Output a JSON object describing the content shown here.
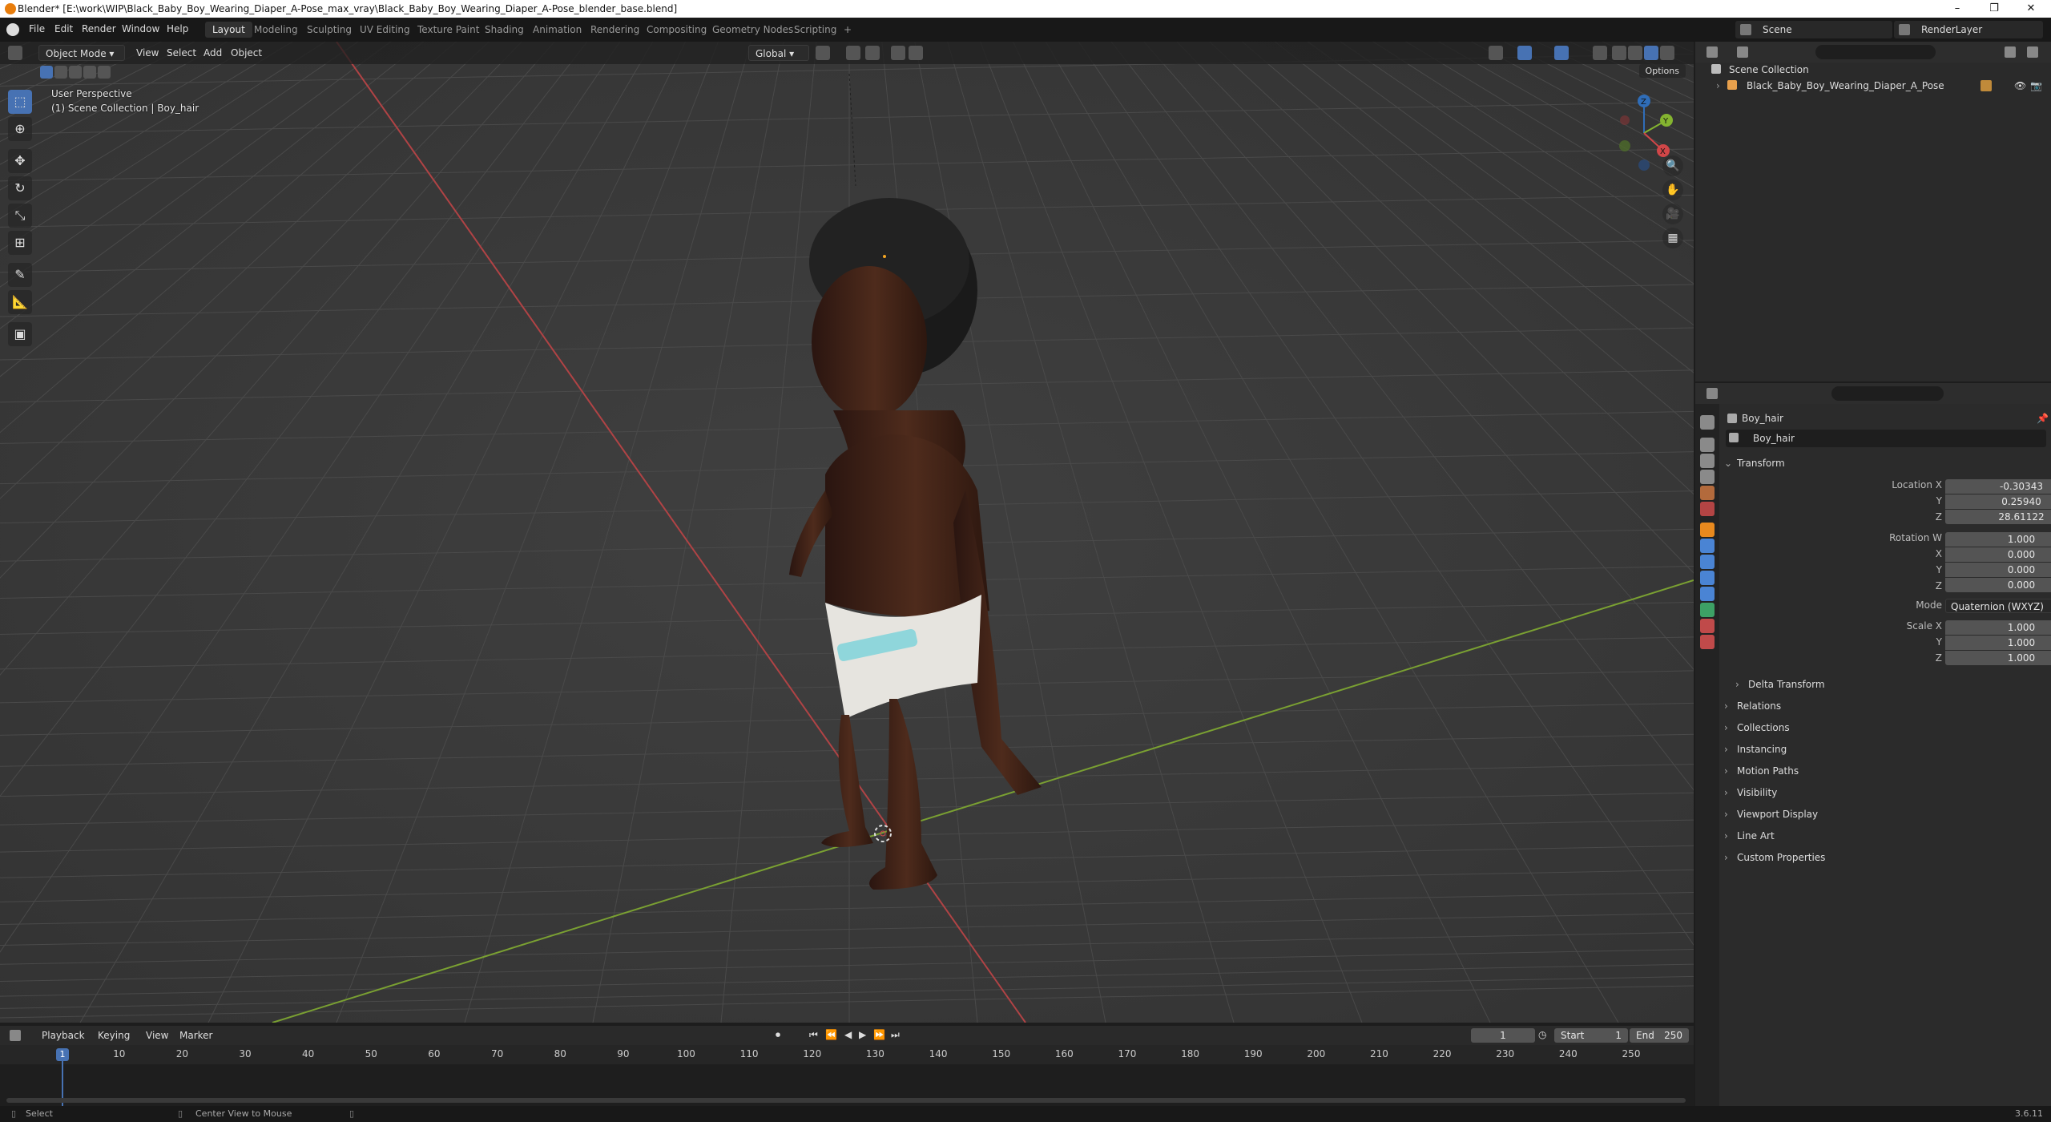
{
  "window": {
    "title": "Blender* [E:\\work\\WIP\\Black_Baby_Boy_Wearing_Diaper_A-Pose_max_vray\\Black_Baby_Boy_Wearing_Diaper_A-Pose_blender_base.blend]",
    "controls": [
      "–",
      "❐",
      "✕"
    ]
  },
  "menu": {
    "items": [
      "File",
      "Edit",
      "Render",
      "Window",
      "Help"
    ]
  },
  "workspaces": {
    "tabs": [
      "Layout",
      "Modeling",
      "Sculpting",
      "UV Editing",
      "Texture Paint",
      "Shading",
      "Animation",
      "Rendering",
      "Compositing",
      "Geometry Nodes",
      "Scripting"
    ],
    "add": "+",
    "active": "Layout"
  },
  "scene": {
    "name": "Scene",
    "view_layer": "RenderLayer"
  },
  "viewport": {
    "mode": "Object Mode",
    "menus": [
      "View",
      "Select",
      "Add",
      "Object"
    ],
    "orientation": "Global",
    "options_label": "Options",
    "overlay_line1": "User Perspective",
    "overlay_line2": "(1) Scene Collection | Boy_hair",
    "gizmo_axes": [
      "Z",
      "Y",
      "X"
    ],
    "bg_color": "#3a3a3a",
    "x_axis_color": "#d04648",
    "y_axis_color": "#84b430"
  },
  "toolbar": {
    "tools": [
      "select-box",
      "cursor",
      "move",
      "rotate",
      "scale",
      "transform",
      "annotate",
      "measure",
      "add-cube"
    ]
  },
  "outliner": {
    "root": "Scene Collection",
    "items": [
      {
        "label": "Black_Baby_Boy_Wearing_Diaper_A_Pose"
      }
    ]
  },
  "properties": {
    "object_name": "Boy_hair",
    "data_name": "Boy_hair",
    "transform_title": "Transform",
    "location_label": "Location X",
    "location": {
      "x": "-0.30343",
      "y": "0.25940",
      "z": "28.61122"
    },
    "rotation_label": "Rotation W",
    "rotation": {
      "w": "1.000",
      "x": "0.000",
      "y": "0.000",
      "z": "0.000"
    },
    "mode_label": "Mode",
    "mode_value": "Quaternion (WXYZ)",
    "scale_label": "Scale X",
    "scale": {
      "x": "1.000",
      "y": "1.000",
      "z": "1.000"
    },
    "axis_y": "Y",
    "axis_z": "Z",
    "axis_x": "X",
    "subpanels": [
      "Delta Transform",
      "Relations",
      "Collections",
      "Instancing",
      "Motion Paths",
      "Visibility",
      "Viewport Display",
      "Line Art",
      "Custom Properties"
    ]
  },
  "timeline": {
    "menus": [
      "Playback",
      "Keying",
      "View",
      "Marker"
    ],
    "current_frame": "1",
    "start_label": "Start",
    "start": "1",
    "end_label": "End",
    "end": "250",
    "ruler": [
      "1",
      "10",
      "20",
      "30",
      "40",
      "50",
      "60",
      "70",
      "80",
      "90",
      "100",
      "110",
      "120",
      "130",
      "140",
      "150",
      "160",
      "170",
      "180",
      "190",
      "200",
      "210",
      "220",
      "230",
      "240",
      "250"
    ]
  },
  "statusbar": {
    "left": "Select",
    "mid": "Center View to Mouse",
    "version": "3.6.11"
  }
}
